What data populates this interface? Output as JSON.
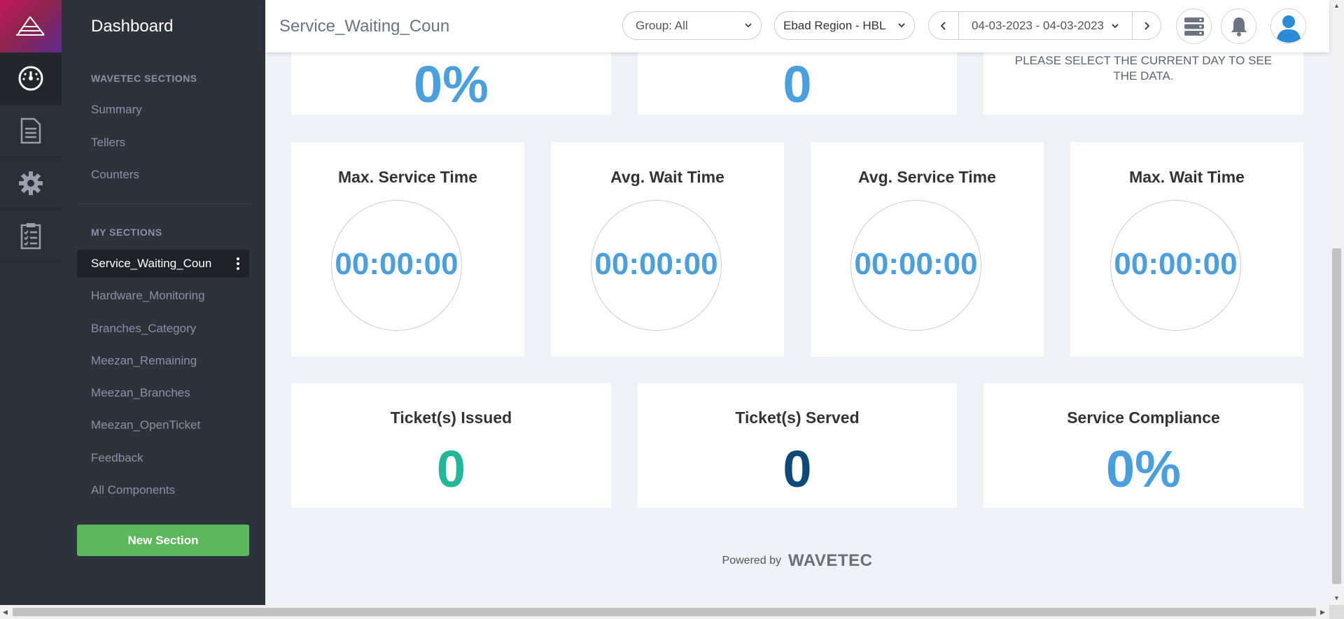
{
  "sidebar": {
    "title": "Dashboard",
    "wavetec_heading": "WAVETEC SECTIONS",
    "wavetec_items": [
      "Summary",
      "Tellers",
      "Counters"
    ],
    "my_heading": "MY SECTIONS",
    "active_item": "Service_Waiting_Coun",
    "my_items": [
      "Hardware_Monitoring",
      "Branches_Category",
      "Meezan_Remaining",
      "Meezan_Branches",
      "Meezan_OpenTicket",
      "Feedback",
      "All Components"
    ],
    "new_section_label": "New Section"
  },
  "rail": {
    "icons": [
      "wavetec-logo-icon",
      "dashboard-gauge-icon",
      "document-icon",
      "gear-icon",
      "clipboard-checklist-icon"
    ]
  },
  "topbar": {
    "title": "Service_Waiting_Coun",
    "group_select": "Group: All",
    "region_select": "Ebad Region - HBL",
    "date_range": "04-03-2023 - 04-03-2023"
  },
  "top_cards": {
    "left_value": "0%",
    "middle_value": "0",
    "right_notice": "PLEASE SELECT THE CURRENT DAY TO SEE THE DATA."
  },
  "timer_cards": [
    {
      "title": "Max. Service Time",
      "value": "00:00:00"
    },
    {
      "title": "Avg. Wait Time",
      "value": "00:00:00"
    },
    {
      "title": "Avg. Service Time",
      "value": "00:00:00"
    },
    {
      "title": "Max. Wait Time",
      "value": "00:00:00"
    }
  ],
  "stat_cards": [
    {
      "title": "Ticket(s) Issued",
      "value": "0",
      "color": "#1fb89a"
    },
    {
      "title": "Ticket(s) Served",
      "value": "0",
      "color": "#0d4a7a"
    },
    {
      "title": "Service Compliance",
      "value": "0%",
      "color": "#4a9fdf"
    }
  ],
  "footer": {
    "powered_by": "Powered by",
    "brand": "WAVETEC"
  },
  "colors": {
    "accent_blue": "#4a9fdf",
    "teal": "#1fb89a",
    "navy": "#0d4a7a",
    "green_button": "#5cb85c",
    "sidebar_bg": "#2e323b"
  }
}
